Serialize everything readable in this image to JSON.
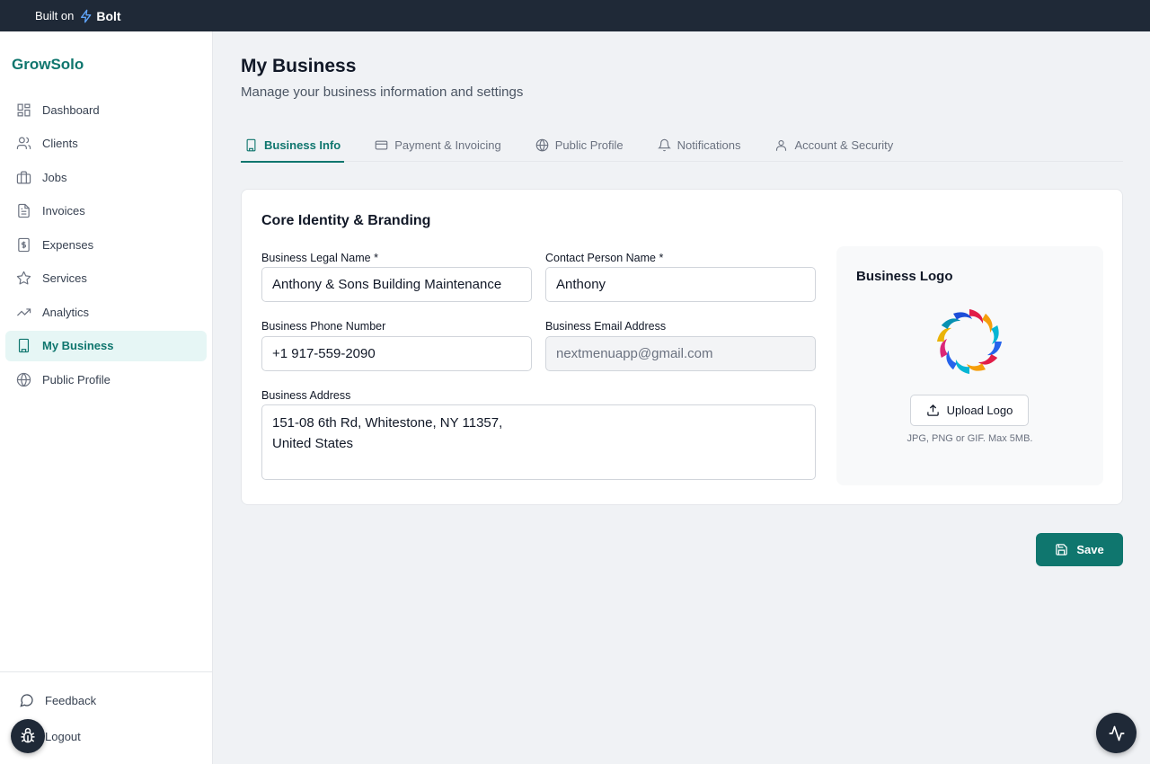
{
  "topbar": {
    "built_on": "Built on",
    "brand": "Bolt"
  },
  "sidebar": {
    "app_name": "GrowSolo",
    "items": [
      {
        "label": "Dashboard",
        "icon": "grid-icon"
      },
      {
        "label": "Clients",
        "icon": "users-icon"
      },
      {
        "label": "Jobs",
        "icon": "briefcase-icon"
      },
      {
        "label": "Invoices",
        "icon": "file-text-icon"
      },
      {
        "label": "Expenses",
        "icon": "dollar-receipt-icon"
      },
      {
        "label": "Services",
        "icon": "star-icon"
      },
      {
        "label": "Analytics",
        "icon": "trending-up-icon"
      },
      {
        "label": "My Business",
        "icon": "building-icon",
        "active": true
      },
      {
        "label": "Public Profile",
        "icon": "globe-icon"
      }
    ],
    "feedback": "Feedback",
    "logout": "Logout"
  },
  "page": {
    "title": "My Business",
    "subtitle": "Manage your business information and settings"
  },
  "tabs": [
    {
      "label": "Business Info",
      "icon": "building-icon",
      "active": true
    },
    {
      "label": "Payment & Invoicing",
      "icon": "credit-card-icon"
    },
    {
      "label": "Public Profile",
      "icon": "globe-icon"
    },
    {
      "label": "Notifications",
      "icon": "bell-icon"
    },
    {
      "label": "Account & Security",
      "icon": "user-icon"
    }
  ],
  "card": {
    "title": "Core Identity & Branding",
    "fields": {
      "legal_name": {
        "label": "Business Legal Name *",
        "value": "Anthony & Sons Building Maintenance"
      },
      "contact": {
        "label": "Contact Person Name *",
        "value": "Anthony"
      },
      "phone": {
        "label": "Business Phone Number",
        "value": "+1 917-559-2090"
      },
      "email": {
        "label": "Business Email Address",
        "value": "nextmenuapp@gmail.com"
      },
      "address": {
        "label": "Business Address",
        "value": "151-08 6th Rd, Whitestone, NY 11357,\nUnited States"
      }
    },
    "logo": {
      "title": "Business Logo",
      "upload_label": "Upload Logo",
      "note": "JPG, PNG or GIF. Max 5MB."
    }
  },
  "actions": {
    "save_label": "Save"
  },
  "colors": {
    "accent": "#0f766e",
    "accent_light": "#e6f6f5",
    "topbar": "#1f2937"
  }
}
